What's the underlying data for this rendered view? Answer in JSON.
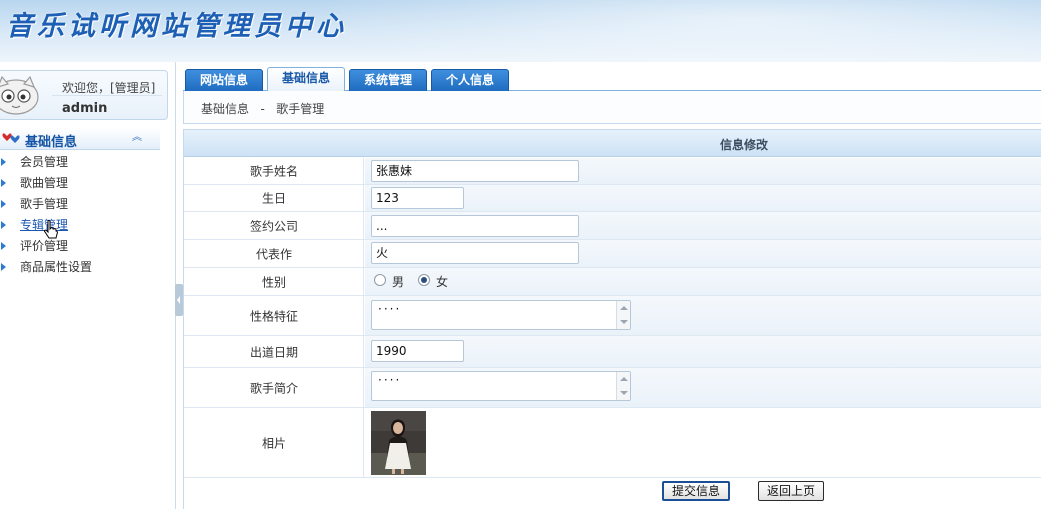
{
  "header": {
    "title": "音乐试听网站管理员中心"
  },
  "user": {
    "welcome": "欢迎您，[管理员]",
    "name": "admin"
  },
  "sidebar": {
    "section_title": "基础信息",
    "items": [
      {
        "label": "会员管理"
      },
      {
        "label": "歌曲管理"
      },
      {
        "label": "歌手管理"
      },
      {
        "label": "专辑管理"
      },
      {
        "label": "评价管理"
      },
      {
        "label": "商品属性设置"
      }
    ]
  },
  "tabs": [
    {
      "label": "网站信息"
    },
    {
      "label": "基础信息"
    },
    {
      "label": "系统管理"
    },
    {
      "label": "个人信息"
    }
  ],
  "breadcrumb": "基础信息   -   歌手管理",
  "form": {
    "title": "信息修改",
    "fields": {
      "name": {
        "label": "歌手姓名",
        "value": "张惠妹"
      },
      "birthday": {
        "label": "生日",
        "value": "123"
      },
      "company": {
        "label": "签约公司",
        "value": "..."
      },
      "works": {
        "label": "代表作",
        "value": "火"
      },
      "gender": {
        "label": "性别",
        "options": [
          "男",
          "女"
        ],
        "selected": "女"
      },
      "personality": {
        "label": "性格特征",
        "value": "····"
      },
      "debut": {
        "label": "出道日期",
        "value": "1990"
      },
      "intro": {
        "label": "歌手简介",
        "value": "····"
      },
      "photo": {
        "label": "相片"
      }
    },
    "submit_label": "提交信息",
    "back_label": "返回上页"
  },
  "colors": {
    "accent": "#1f6cc0",
    "title": "#1c5fb4",
    "row_bg": "#eaf2f9"
  }
}
